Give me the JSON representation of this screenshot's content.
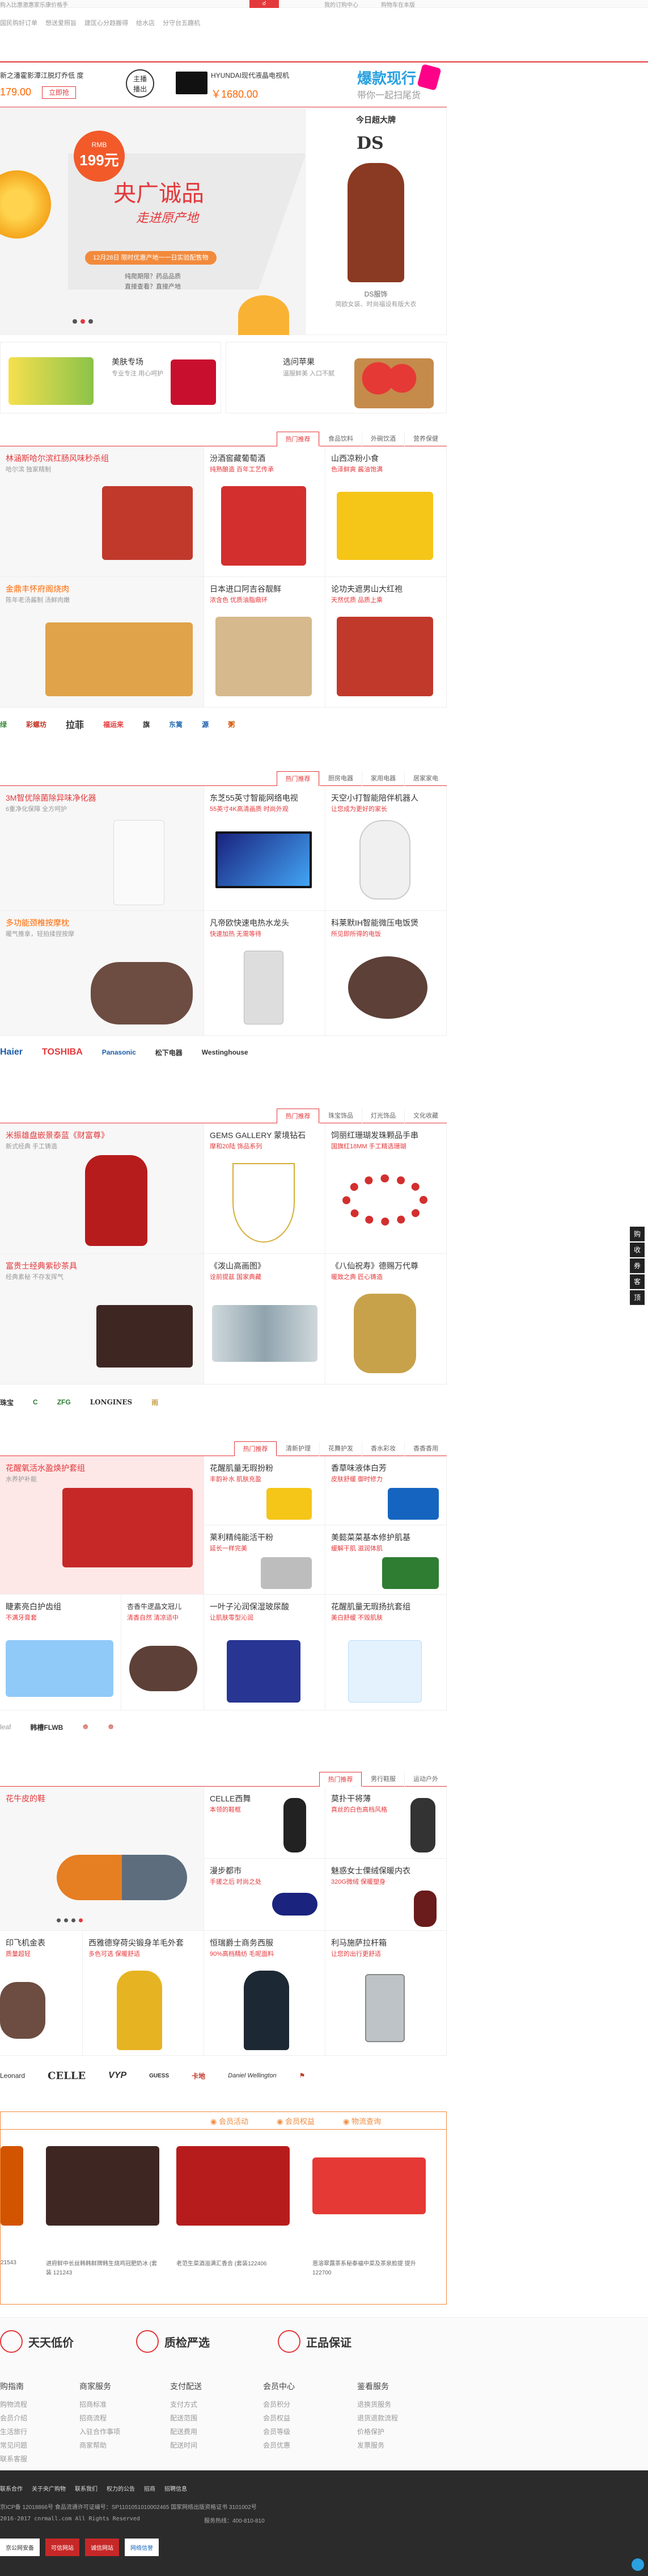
{
  "topbar": {
    "search_hint": "购入比惠激惠家乐康价格手",
    "links": [
      "国民购好订单",
      "想送爱照旨",
      "建匡心分趋搬得",
      "给水店",
      "分守台五趣机"
    ],
    "orders": "我的订购中心",
    "cart": "购物车在本版"
  },
  "promo": {
    "price1": "179.00",
    "btn": "立即抢",
    "live_label": "主播",
    "live_label2": "播出",
    "tv_name": "HYUNDAI现代液晶电视机",
    "tv_price": "￥1680.00",
    "hot_title": "爆款现行",
    "hot_sub": "带你一起扫尾货",
    "left_name": "新之潘霍影潭江脱灯乔低 度"
  },
  "hero": {
    "badge_text": "RMB",
    "badge_price": "199元",
    "headline": "央广诚品",
    "sub": "走进原产地",
    "date_line": "12月28日 限时优惠产地一一日实验配售物",
    "points": [
      "纯爬期限？药品品质",
      "直接查看？直接产地"
    ]
  },
  "daily": {
    "title": "今日超大牌",
    "brand": "DS",
    "model": "DS服饰",
    "caption": "简欧女装、时尚福设有版大衣"
  },
  "cards": [
    {
      "title": "美肤专场",
      "sub": "专业专注 用心呵护"
    },
    {
      "title": "选问苹果",
      "sub": "温服鲜美 入口不腻"
    }
  ],
  "floor1": {
    "tabs": [
      "热门推荐",
      "食品饮料",
      "外碗饮酒",
      "营养保健"
    ],
    "cells": [
      {
        "t": "林涵斯哈尔滨红肠风味秒杀组",
        "s": "哈尔滨 独家精制"
      },
      {
        "t": "汾酒窖藏葡萄酒",
        "s": "纯熟酿造 百年工艺传承"
      },
      {
        "t": "山西凉粉小食",
        "s": "色泽鲜爽 酱油饱满"
      },
      {
        "t": "金鼎丰怀府阁烧肉",
        "s": "陈年老汤酱制 汤鲜肉嫩"
      },
      {
        "t": "日本进口阿吉谷靓鲜",
        "s": "浓含色 优质油脂鼎环"
      },
      {
        "t": "论功夫遮男山大红袍",
        "s": "天然优质 品质上乘"
      }
    ],
    "brands": [
      "绿",
      "彩螺坊",
      "拉菲",
      "福运来",
      "旗",
      "东篱",
      "源",
      "粥"
    ]
  },
  "floor2": {
    "tabs": [
      "热门推荐",
      "厨房电器",
      "家用电器",
      "居家家电"
    ],
    "cells": [
      {
        "t": "3M智优除菌除异味净化器",
        "s": "6重净化保障 全方呵护"
      },
      {
        "t": "东芝55英寸智能网络电视",
        "s": "55英寸4K高清画质 时尚外观"
      },
      {
        "t": "天空小打智能陪伴机器人",
        "s": "让您成为更好的家长"
      },
      {
        "t": "多功能颈椎按摩枕",
        "s": "暖气推拿，轻拍揉捏按摩"
      },
      {
        "t": "凡帝欧快速电热水龙头",
        "s": "快速加热 无需等待"
      },
      {
        "t": "科莱默IH智能微压电饭煲",
        "s": "所见即所得的电饭"
      }
    ],
    "brands": [
      "Haier",
      "TOSHIBA",
      "Panasonic",
      "松下电器",
      "Westinghouse"
    ]
  },
  "floor3": {
    "tabs": [
      "热门推荐",
      "珠宝饰品",
      "灯光饰品",
      "文化收藏"
    ],
    "cells": [
      {
        "t": "米振雄盘嵌景泰蓝《财富尊》",
        "s": "新式经典 手工铸造",
        "g": true
      },
      {
        "t": "GEMS GALLERY 蒙境钻石",
        "s": "摩和20陆 饰品系列"
      },
      {
        "t": "饲丽红珊瑚发珠颗品手串",
        "s": "国旗红18MM 手工精选珊瑚"
      },
      {
        "t": "富贵士经典紫砂茶具",
        "s": "经典素秘 不存发挥气",
        "g": true
      },
      {
        "t": "《泼山高画图》",
        "s": "诠前提兹 国家典藏"
      },
      {
        "t": "《八仙祝寿》德赐万代尊",
        "s": "暖致之典 匠心铸造"
      }
    ],
    "brands": [
      "珠宝",
      "C",
      "ZFG",
      "LONGINES",
      "雨"
    ]
  },
  "floor4": {
    "tabs": [
      "热门推荐",
      "清新护理",
      "花舞护发",
      "香水彩妆",
      "香香香用"
    ],
    "cells": [
      {
        "t": "花醒氧活水盈焕护套组",
        "s": "水养护补能",
        "g": true
      },
      {
        "t": "花醒肌量无瑕扮粉",
        "s": "丰韵补水 肌肤充盈"
      },
      {
        "t": "香草味液体白芳",
        "s": "皮肤舒缓 御时修力"
      },
      {
        "t": "莱利精纯能活干粉",
        "s": "延长一样完美"
      },
      {
        "t": "美懿菜菜基本修护肌基",
        "s": "缓解干肌 滋润体肌"
      },
      {
        "t": "睫素亮白护齿组",
        "s": "不满牙膏套"
      },
      {
        "t": "杏香牛逻晶文冠儿",
        "s": "清香自然 清凉适中"
      },
      {
        "t": "一叶子沁润保湿玻尿酸",
        "s": "让肌肤零型沁润"
      },
      {
        "t": "花醒肌量无瑕扬抗套组",
        "s": "美白舒缓 不毁肌肤"
      }
    ],
    "brands": [
      "leaf",
      "韩槽FLWB",
      "☸",
      "☸"
    ]
  },
  "floor5": {
    "tabs": [
      "热门推荐",
      "男行鞋服",
      "运动户外"
    ],
    "cells": [
      {
        "t": "花牛皮的鞋",
        "s": ""
      },
      {
        "t": "CELLE西舞",
        "s": "本领的鞋框"
      },
      {
        "t": "莫扑干将薄",
        "s": "真丝的白色高档风格"
      },
      {
        "t": "漫步都市",
        "s": "手搓之后 时尚之处"
      },
      {
        "t": "魅惑女士傈绒保暖内衣",
        "s": "320G微绒 保暖塑身"
      },
      {
        "t": "印飞机金表",
        "s": "质量超轻"
      },
      {
        "t": "西雅德穿荷尖锻身羊毛外套",
        "s": "多色可选 保暖舒适"
      },
      {
        "t": "恒瑞爵士商务西服",
        "s": "90%高档精纺 毛呢面料"
      },
      {
        "t": "利马施萨拉杆箱",
        "s": "让您的出行更舒适"
      }
    ],
    "brands": [
      "Leonard",
      "CELLE",
      "VYP",
      "GUESS",
      "卡地",
      "Daniel Wellington",
      "⚑"
    ]
  },
  "member": {
    "tabs": [
      "会员活动",
      "会员权益",
      "物流查询"
    ],
    "items": [
      "21543",
      "进府鲜中长丝韩韩鲜牌韩生烧鸡冠肥奶冰 (套装 121243",
      "老范生菜酒溢满汇香合 (套装122406",
      "恩溶翠露茶系秘泰福中菜及茶泉脸提 提升122700"
    ]
  },
  "guarantee": [
    "天天低价",
    "质检严选",
    "正品保证"
  ],
  "footer": {
    "cols": [
      {
        "h": "购指南",
        "l": [
          "购物流程",
          "会员介绍",
          "生活旅行",
          "常见问题",
          "联系客服"
        ]
      },
      {
        "h": "商家服务",
        "l": [
          "招商标准",
          "招商流程",
          "入驻合作事项",
          "商家帮助"
        ]
      },
      {
        "h": "支付配送",
        "l": [
          "支付方式",
          "配送范围",
          "配送费用",
          "配送时间"
        ]
      },
      {
        "h": "会员中心",
        "l": [
          "会员积分",
          "会员权益",
          "会员等级",
          "会员优惠"
        ]
      },
      {
        "h": "鉴看服务",
        "l": [
          "退换货服务",
          "退货退款流程",
          "价格保护",
          "发票服务"
        ]
      }
    ],
    "links": [
      "联系合作",
      "关于央广购物",
      "联系我们",
      "权力的公告",
      "招商",
      "招聘信息"
    ],
    "license": "京ICP备 12018866号  食品流通许可证编号：SP1101051010002465  国家网络出版资格证书  3101002号",
    "copyright": "2016-2017 cnrmall.com All Rights Reserved",
    "hotline": "服务热线：400-810-810",
    "badges": [
      "京公网安备",
      "可信网站",
      "诚信网站",
      "网络信誉"
    ]
  },
  "sidebar": [
    "购",
    "收",
    "券",
    "客",
    "顶"
  ]
}
